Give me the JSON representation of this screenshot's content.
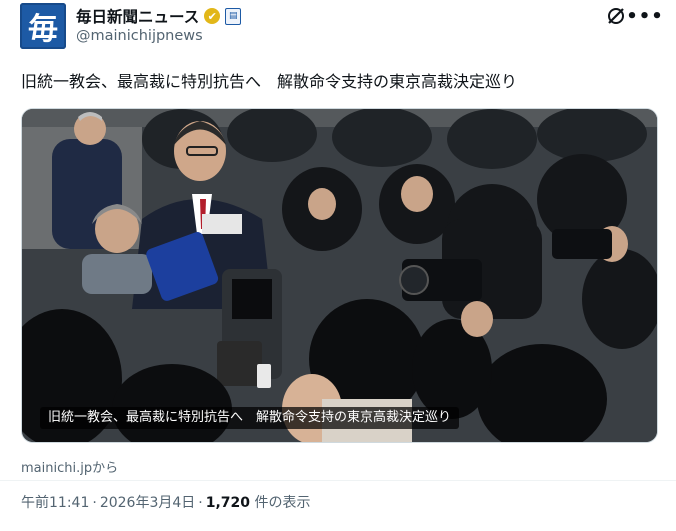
{
  "account": {
    "avatar_char": "毎",
    "display_name": "毎日新聞ニュース",
    "handle": "@mainichijpnews",
    "verified_badge": "✔",
    "org_badge_char": "▤"
  },
  "toolbar": {
    "grok_icon": "grok-icon",
    "more_label": "•••"
  },
  "tweet": {
    "text": "旧統一教会、最高裁に特別抗告へ　解散命令支持の東京高裁決定巡り",
    "image_caption": "旧統一教会、最高裁に特別抗告へ　解散命令支持の東京高裁決定巡り",
    "source": "mainichi.jpから",
    "time": "午前11:41",
    "separator": "·",
    "date": "2026年3月4日",
    "views_count": "1,720",
    "views_label": " 件の表示"
  },
  "colors": {
    "brand": "#1d5aa5",
    "verified": "#e2b719",
    "text": "#0f1419",
    "secondary": "#536471"
  }
}
